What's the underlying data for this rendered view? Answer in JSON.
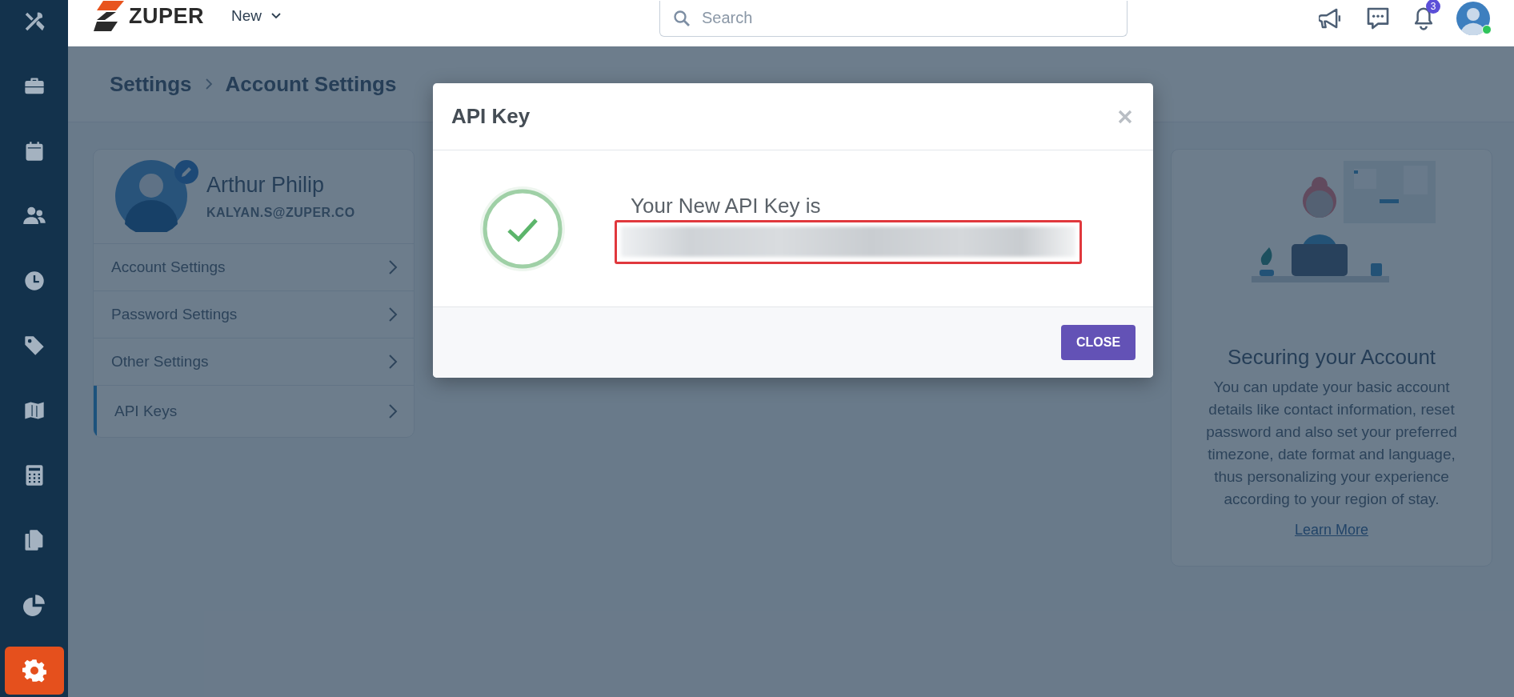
{
  "sidebar": {
    "items": [
      {
        "kind": "tools",
        "selected": false
      },
      {
        "kind": "briefcase",
        "selected": false
      },
      {
        "kind": "calendar",
        "selected": false
      },
      {
        "kind": "people",
        "selected": false
      },
      {
        "kind": "clock",
        "selected": false
      },
      {
        "kind": "tag",
        "selected": false
      },
      {
        "kind": "map",
        "selected": false
      },
      {
        "kind": "calculator",
        "selected": false
      },
      {
        "kind": "documents",
        "selected": false
      },
      {
        "kind": "chart",
        "selected": false
      },
      {
        "kind": "settings",
        "selected": true
      }
    ]
  },
  "topbar": {
    "logo": "ZUPER",
    "new_menu": "New",
    "search": {
      "placeholder": "Search"
    },
    "notification_count": "3"
  },
  "breadcrumb": [
    "Settings",
    "Account Settings"
  ],
  "profile": {
    "name": "Arthur Philip",
    "email": "KALYAN.S@ZUPER.CO"
  },
  "menu": [
    {
      "label": "Account Settings",
      "selected": false
    },
    {
      "label": "Password Settings",
      "selected": false
    },
    {
      "label": "Other Settings",
      "selected": false
    },
    {
      "label": "API Keys",
      "selected": true
    }
  ],
  "info_card": {
    "title": "Securing your Account",
    "body": "You can update your basic account details like contact information, reset password and also set your preferred timezone, date format and language, thus personalizing your experience according to your region of stay.",
    "link": "Learn More"
  },
  "modal": {
    "title": "API Key",
    "message": "Your New API Key is",
    "close_button": "CLOSE"
  }
}
